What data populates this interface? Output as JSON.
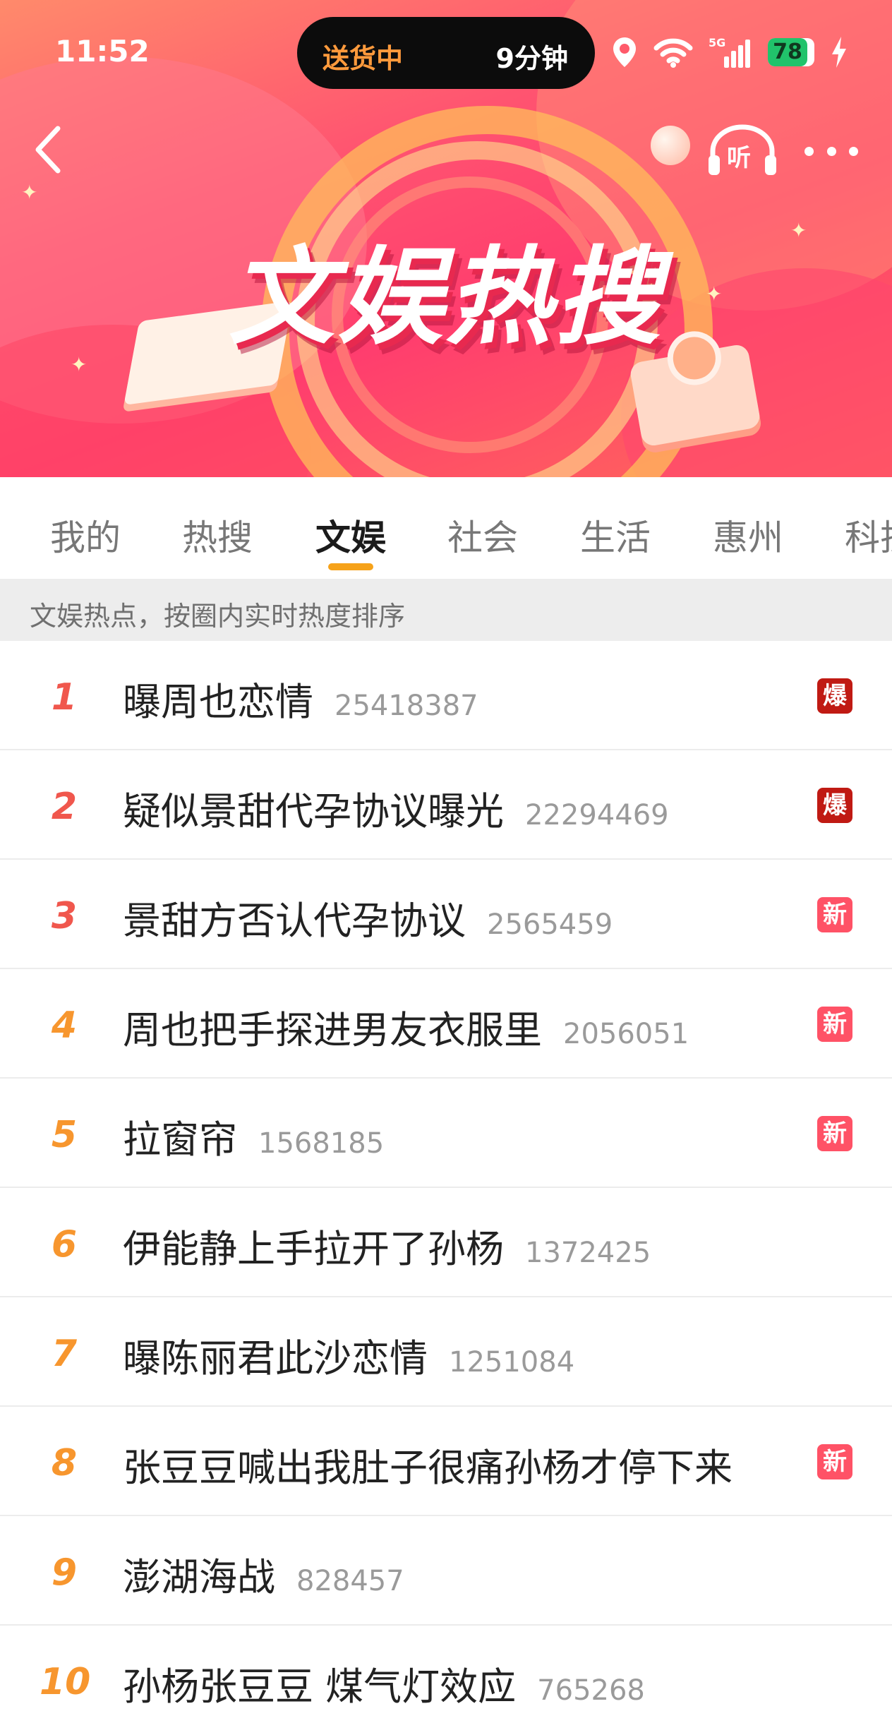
{
  "status_bar": {
    "time": "11:52",
    "island_left": "送货中",
    "island_right": "9分钟",
    "network": "5G",
    "battery": "78"
  },
  "header": {
    "banner_title": "文娱热搜",
    "listen_label": "听",
    "icons": [
      "back-icon",
      "headphones-icon",
      "more-icon",
      "location-icon",
      "wifi-icon",
      "signal-icon",
      "battery-icon",
      "charging-icon"
    ]
  },
  "tabs": [
    {
      "label": "我的",
      "active": false
    },
    {
      "label": "热搜",
      "active": false
    },
    {
      "label": "文娱",
      "active": true
    },
    {
      "label": "社会",
      "active": false
    },
    {
      "label": "生活",
      "active": false
    },
    {
      "label": "惠州",
      "active": false
    },
    {
      "label": "科技",
      "active": false
    }
  ],
  "subheader": "文娱热点，按圈内实时热度排序",
  "colors": {
    "accent": "#f6a21a",
    "rank_top": "#f0574d",
    "rank_mid": "#f7962e",
    "badge_bao": "#c01a13",
    "badge_xin": "#ff5266"
  },
  "list": [
    {
      "rank": "1",
      "title": "曝周也恋情",
      "count": "25418387",
      "badge": "爆"
    },
    {
      "rank": "2",
      "title": "疑似景甜代孕协议曝光",
      "count": "22294469",
      "badge": "爆"
    },
    {
      "rank": "3",
      "title": "景甜方否认代孕协议",
      "count": "2565459",
      "badge": "新"
    },
    {
      "rank": "4",
      "title": "周也把手探进男友衣服里",
      "count": "2056051",
      "badge": "新"
    },
    {
      "rank": "5",
      "title": "拉窗帘",
      "count": "1568185",
      "badge": "新"
    },
    {
      "rank": "6",
      "title": "伊能静上手拉开了孙杨",
      "count": "1372425",
      "badge": ""
    },
    {
      "rank": "7",
      "title": "曝陈丽君此沙恋情",
      "count": "1251084",
      "badge": ""
    },
    {
      "rank": "8",
      "title": "张豆豆喊出我肚子很痛孙杨才停下来",
      "count": "",
      "badge": "新"
    },
    {
      "rank": "9",
      "title": "澎湖海战",
      "count": "828457",
      "badge": ""
    },
    {
      "rank": "10",
      "title": "孙杨张豆豆 煤气灯效应",
      "count": "765268",
      "badge": ""
    }
  ]
}
